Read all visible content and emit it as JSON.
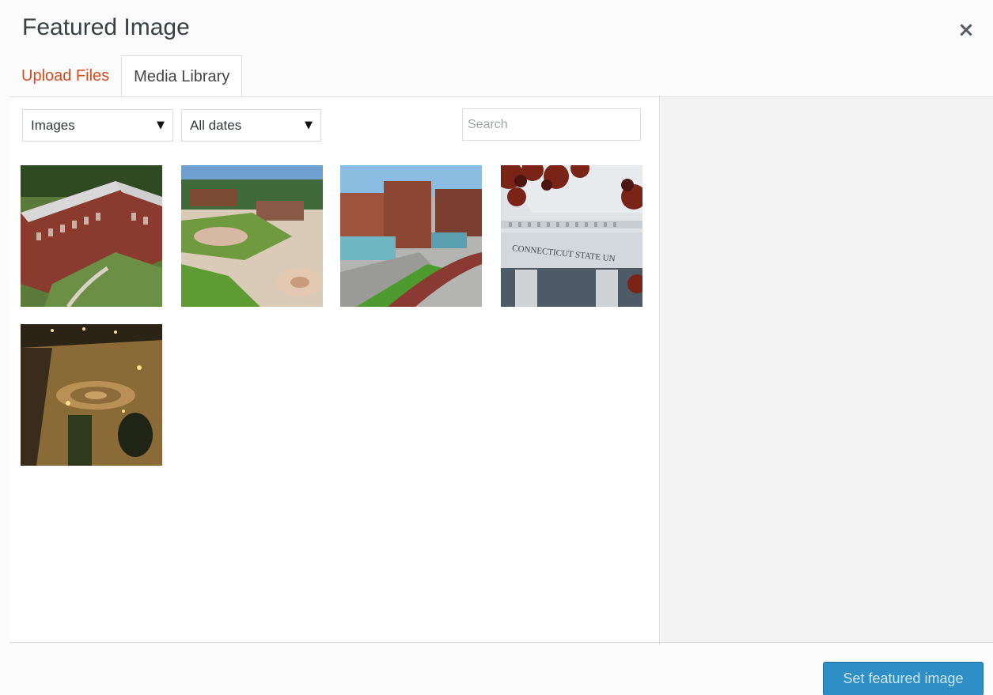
{
  "modal": {
    "title": "Featured Image",
    "close_icon": "close-icon",
    "close_glyph": "×"
  },
  "tabs": [
    {
      "label": "Upload Files",
      "active": false
    },
    {
      "label": "Media Library",
      "active": true
    }
  ],
  "filters": {
    "type_value": "Images",
    "date_value": "All dates",
    "caret_glyph": "▼",
    "search_placeholder": "Search",
    "search_value": ""
  },
  "thumbnails": [
    {
      "name": "campus-residence-hall-aerial",
      "selected": false
    },
    {
      "name": "campus-plaza-aerial",
      "selected": false
    },
    {
      "name": "campus-brick-building-walkway",
      "selected": false
    },
    {
      "name": "connecticut-state-building-facade",
      "selected": false,
      "engraved_text": "CONNECTICUT STATE UN"
    },
    {
      "name": "campus-plaza-night",
      "selected": false
    }
  ],
  "footer": {
    "primary_label": "Set featured image"
  },
  "colors": {
    "accent": "#d54e21",
    "primary_button": "#2e8fc7",
    "sidebar_bg": "#f3f3f3"
  }
}
